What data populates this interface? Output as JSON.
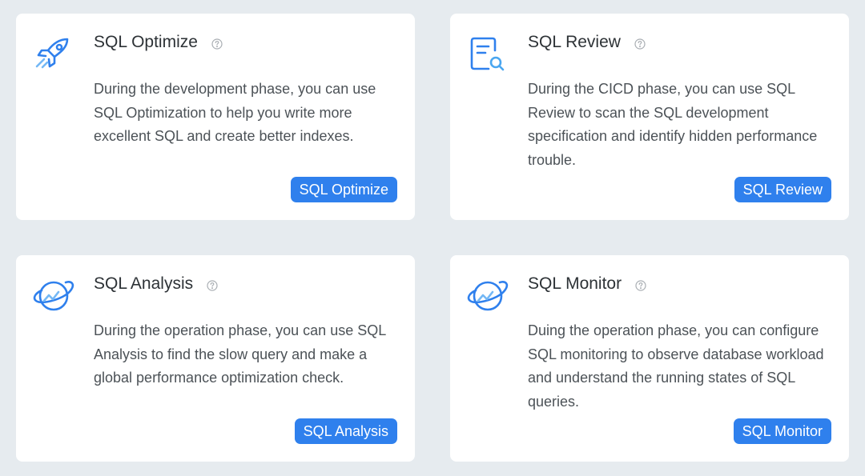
{
  "colors": {
    "accent": "#2f80ed",
    "page_background": "#e6ebef",
    "card_background": "#ffffff",
    "title_text": "#2d3236",
    "body_text": "#4c5257"
  },
  "cards": [
    {
      "icon": "rocket-icon",
      "title": "SQL Optimize",
      "description": "During the development phase, you can use SQL Optimization to help you write more excellent SQL and create better indexes.",
      "button_label": "SQL Optimize"
    },
    {
      "icon": "document-search-icon",
      "title": "SQL Review",
      "description": "During the CICD phase, you can use SQL Review to scan the SQL development specification and identify hidden performance trouble.",
      "button_label": "SQL Review"
    },
    {
      "icon": "planet-chart-icon",
      "title": "SQL Analysis",
      "description": "During the operation phase, you can use SQL Analysis to find the slow query and make a global performance optimization check.",
      "button_label": "SQL Analysis"
    },
    {
      "icon": "planet-chart-icon",
      "title": "SQL Monitor",
      "description": "Duing the operation phase, you can configure SQL monitoring to observe database workload and understand the running states of SQL queries.",
      "button_label": "SQL Monitor"
    }
  ]
}
